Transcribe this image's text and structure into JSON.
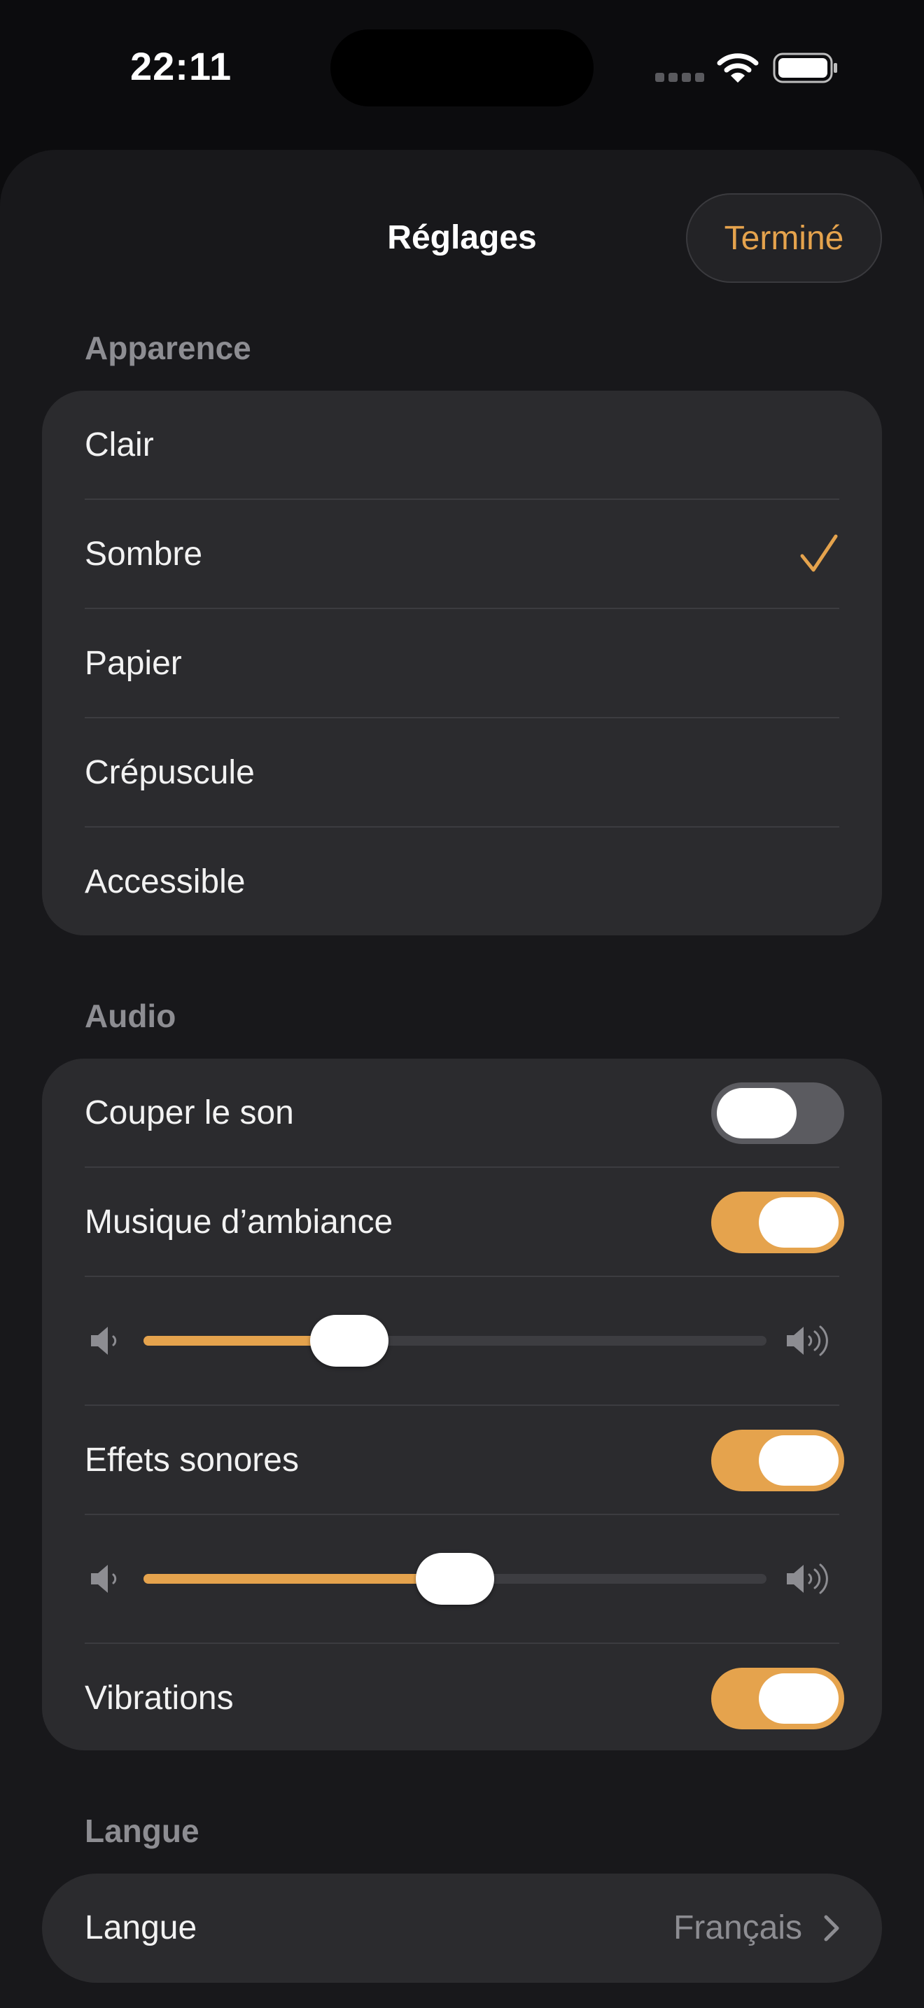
{
  "status_bar": {
    "time": "22:11"
  },
  "header": {
    "title": "Réglages",
    "done_label": "Terminé"
  },
  "appearance": {
    "section_title": "Apparence",
    "options": [
      {
        "label": "Clair",
        "selected": false
      },
      {
        "label": "Sombre",
        "selected": true
      },
      {
        "label": "Papier",
        "selected": false
      },
      {
        "label": "Crépuscule",
        "selected": false
      },
      {
        "label": "Accessible",
        "selected": false
      }
    ]
  },
  "audio": {
    "section_title": "Audio",
    "mute": {
      "label": "Couper le son",
      "on": false
    },
    "music": {
      "label": "Musique d’ambiance",
      "on": true,
      "volume": 0.33
    },
    "effects": {
      "label": "Effets sonores",
      "on": true,
      "volume": 0.5
    },
    "vibrations": {
      "label": "Vibrations",
      "on": true
    }
  },
  "language": {
    "section_title": "Langue",
    "label": "Langue",
    "value": "Français"
  },
  "colors": {
    "accent": "#e5a34d",
    "background": "#0c0c0e",
    "sheet": "#18181b",
    "card": "#2b2b2e"
  },
  "icons": [
    "wifi-icon",
    "battery-icon",
    "checkmark-icon",
    "speaker-low-icon",
    "speaker-high-icon",
    "chevron-right-icon"
  ]
}
